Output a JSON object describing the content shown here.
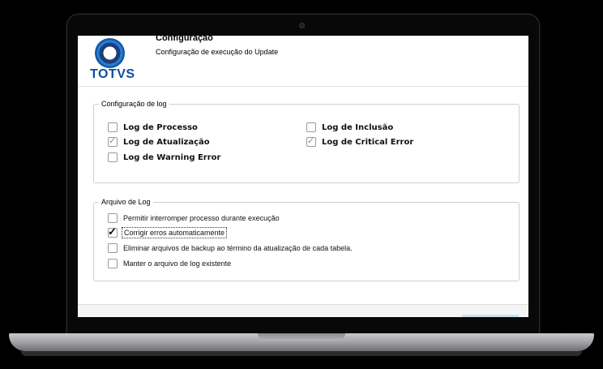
{
  "header": {
    "logo_text": "TOTVS",
    "title": "Configuração",
    "subtitle": "Configuração de execução do Update"
  },
  "log_config": {
    "legend": "Configuração de log",
    "options": [
      {
        "label": "Log de Processo",
        "checked": false
      },
      {
        "label": "Log de Atualização",
        "checked": true
      },
      {
        "label": "Log de Warning Error",
        "checked": false
      },
      {
        "label": "Log de Inclusão",
        "checked": false
      },
      {
        "label": "Log de Critical Error",
        "checked": true
      }
    ]
  },
  "log_file": {
    "legend": "Arquivo de Log",
    "options": [
      {
        "label": "Permitir interromper processo durante execução",
        "checked": false
      },
      {
        "label": "Corrigir erros automaticamente",
        "checked": true,
        "focused": true
      },
      {
        "label": "Eliminar arquivos de backup ao término da atualização de cada tabela.",
        "checked": false
      },
      {
        "label": "Manter o arquivo de log existente",
        "checked": false
      }
    ]
  },
  "colors": {
    "logo_blue": "#0b4da2",
    "frame": "#080808",
    "screen_bg": "#ffffff"
  }
}
